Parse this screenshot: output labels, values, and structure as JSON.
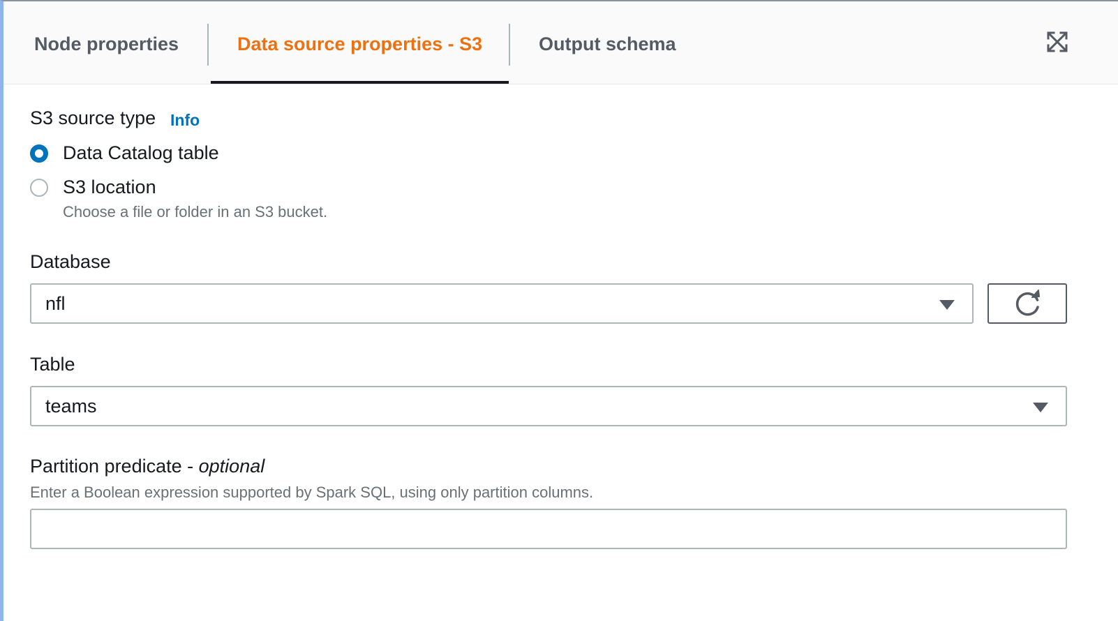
{
  "tabs": [
    {
      "label": "Node properties",
      "active": false
    },
    {
      "label": "Data source properties - S3",
      "active": true
    },
    {
      "label": "Output schema",
      "active": false
    }
  ],
  "expand_icon": "expand-arrows-icon",
  "source_type": {
    "label": "S3 source type",
    "info_link": "Info",
    "options": [
      {
        "label": "Data Catalog table",
        "selected": true
      },
      {
        "label": "S3 location",
        "selected": false,
        "description": "Choose a file or folder in an S3 bucket."
      }
    ]
  },
  "database": {
    "label": "Database",
    "value": "nfl",
    "refresh_icon": "refresh-icon"
  },
  "table": {
    "label": "Table",
    "value": "teams"
  },
  "partition_predicate": {
    "label": "Partition predicate -",
    "label_optional": "optional",
    "description": "Enter a Boolean expression supported by Spark SQL, using only partition columns.",
    "value": "",
    "placeholder": ""
  },
  "colors": {
    "active_tab": "#ec7211",
    "link": "#0073bb",
    "radio_selected": "#0073bb"
  }
}
